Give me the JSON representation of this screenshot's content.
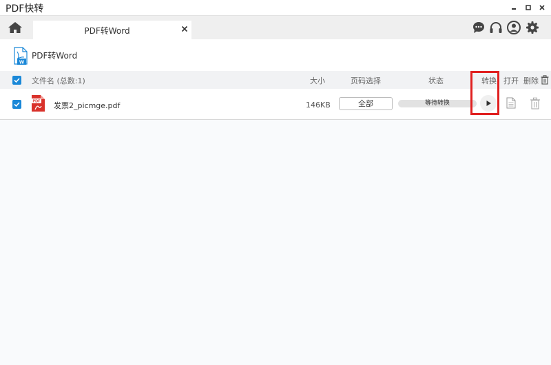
{
  "app": {
    "title": "PDF快转"
  },
  "tabs": [
    {
      "label": "PDF转Word"
    }
  ],
  "page": {
    "title": "PDF转Word"
  },
  "table": {
    "headers": {
      "filename": "文件名 (总数:1)",
      "size": "大小",
      "page_select": "页码选择",
      "status": "状态",
      "convert": "转换",
      "open": "打开",
      "delete": "删除"
    },
    "rows": [
      {
        "name": "发票2_picmge.pdf",
        "size": "146KB",
        "pages": "全部",
        "status": "等待转换"
      }
    ]
  },
  "icons": {
    "home": "home-icon",
    "feedback": "chat-icon",
    "support": "headphones-icon",
    "account": "user-icon",
    "settings": "gear-icon",
    "file_type": "pdf-file-icon",
    "convert": "play-icon",
    "open": "document-icon",
    "delete": "trash-icon"
  },
  "colors": {
    "accent": "#1a88d8",
    "highlight": "#e02020",
    "pdf": "#d9322b"
  }
}
